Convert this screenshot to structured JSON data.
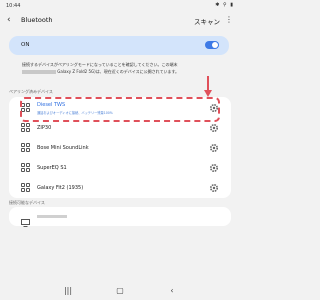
{
  "status_bar": {
    "time": "10:44",
    "icons": "✱ ⚲ ▮"
  },
  "header": {
    "title": "Bluetooth",
    "scan_label": "スキャン"
  },
  "toggle": {
    "label": "ON",
    "state": "on"
  },
  "notice": {
    "line1": "接続するデバイスがペアリングモードになっていることを確認してください。この端末",
    "line2_after_redact": "Galaxy Z Fold2 5G)は、現在近くのデバイスに公開されています。"
  },
  "paired_section": {
    "label": "ペアリング済みデバイス",
    "devices": [
      {
        "name": "Diesel TWS",
        "sub": "通話およびオーディオに接続、バッテリー残量100%",
        "highlighted": true
      },
      {
        "name": "ZIP30"
      },
      {
        "name": "Bose Mini SoundLink"
      },
      {
        "name": "SuperEQ S1"
      },
      {
        "name": "Galaxy Fit2 (1935)"
      }
    ]
  },
  "available_section": {
    "label": "接続可能なデバイス"
  },
  "colors": {
    "accent": "#3e7ae6",
    "highlight": "#e0505a",
    "toggle_bg": "#d3e4fb"
  },
  "icons": [
    "back-arrow-icon",
    "more-options-icon",
    "device-grid-icon",
    "gear-icon",
    "monitor-icon",
    "recents-icon",
    "home-icon",
    "back-icon"
  ]
}
